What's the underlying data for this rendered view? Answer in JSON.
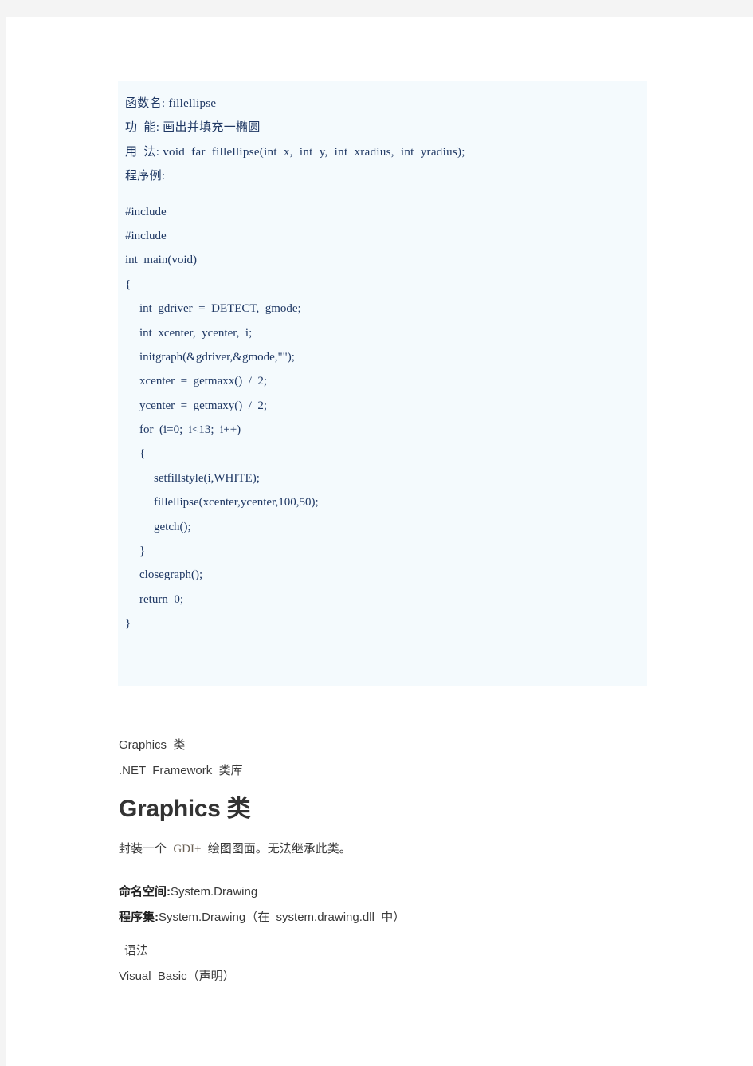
{
  "colors": {
    "page_background": "#ffffff",
    "outer_background": "#f4f4f4",
    "code_block_background": "#f4fafd",
    "code_text": "#1f3864",
    "doc_text": "#3a3a3a",
    "heading_text": "#333333",
    "inline_serif_text": "#6b6155"
  },
  "reference_block": {
    "header_lines": [
      "函数名: fillellipse",
      "功  能: 画出并填充一椭圆",
      "用  法: void  far  fillellipse(int  x,  int  y,  int  xradius,  int  yradius);",
      "程序例:"
    ],
    "code_lines": [
      {
        "text": "#include",
        "indent": 0
      },
      {
        "text": "#include",
        "indent": 0
      },
      {
        "text": "int  main(void)",
        "indent": 0
      },
      {
        "text": "{",
        "indent": 0
      },
      {
        "text": "int  gdriver  =  DETECT,  gmode;",
        "indent": 1
      },
      {
        "text": "int  xcenter,  ycenter,  i;",
        "indent": 1
      },
      {
        "text": "initgraph(&gdriver,&gmode,\"\");",
        "indent": 1
      },
      {
        "text": "xcenter  =  getmaxx()  /  2;",
        "indent": 1
      },
      {
        "text": "ycenter  =  getmaxy()  /  2;",
        "indent": 1
      },
      {
        "text": "for  (i=0;  i<13;  i++)",
        "indent": 1
      },
      {
        "text": "{",
        "indent": 1
      },
      {
        "text": "setfillstyle(i,WHITE);",
        "indent": 2
      },
      {
        "text": "fillellipse(xcenter,ycenter,100,50);",
        "indent": 2
      },
      {
        "text": "getch();",
        "indent": 2
      },
      {
        "text": "}",
        "indent": 1
      },
      {
        "text": "closegraph();",
        "indent": 1
      },
      {
        "text": "return  0;",
        "indent": 1
      },
      {
        "text": "}",
        "indent": 0
      }
    ]
  },
  "documentation": {
    "breadcrumb_class": "Graphics  类",
    "breadcrumb_library": ".NET  Framework  类库",
    "heading": "Graphics 类",
    "summary_prefix": "封装一个  ",
    "summary_inline_code": "GDI+",
    "summary_suffix": "  绘图图面。无法继承此类。",
    "namespace_label": "命名空间:",
    "namespace_value": "System.Drawing",
    "assembly_label": "程序集:",
    "assembly_value": "System.Drawing（在  system.drawing.dll  中）",
    "syntax_section_title": "语法",
    "syntax_language": "Visual  Basic（声明）"
  }
}
